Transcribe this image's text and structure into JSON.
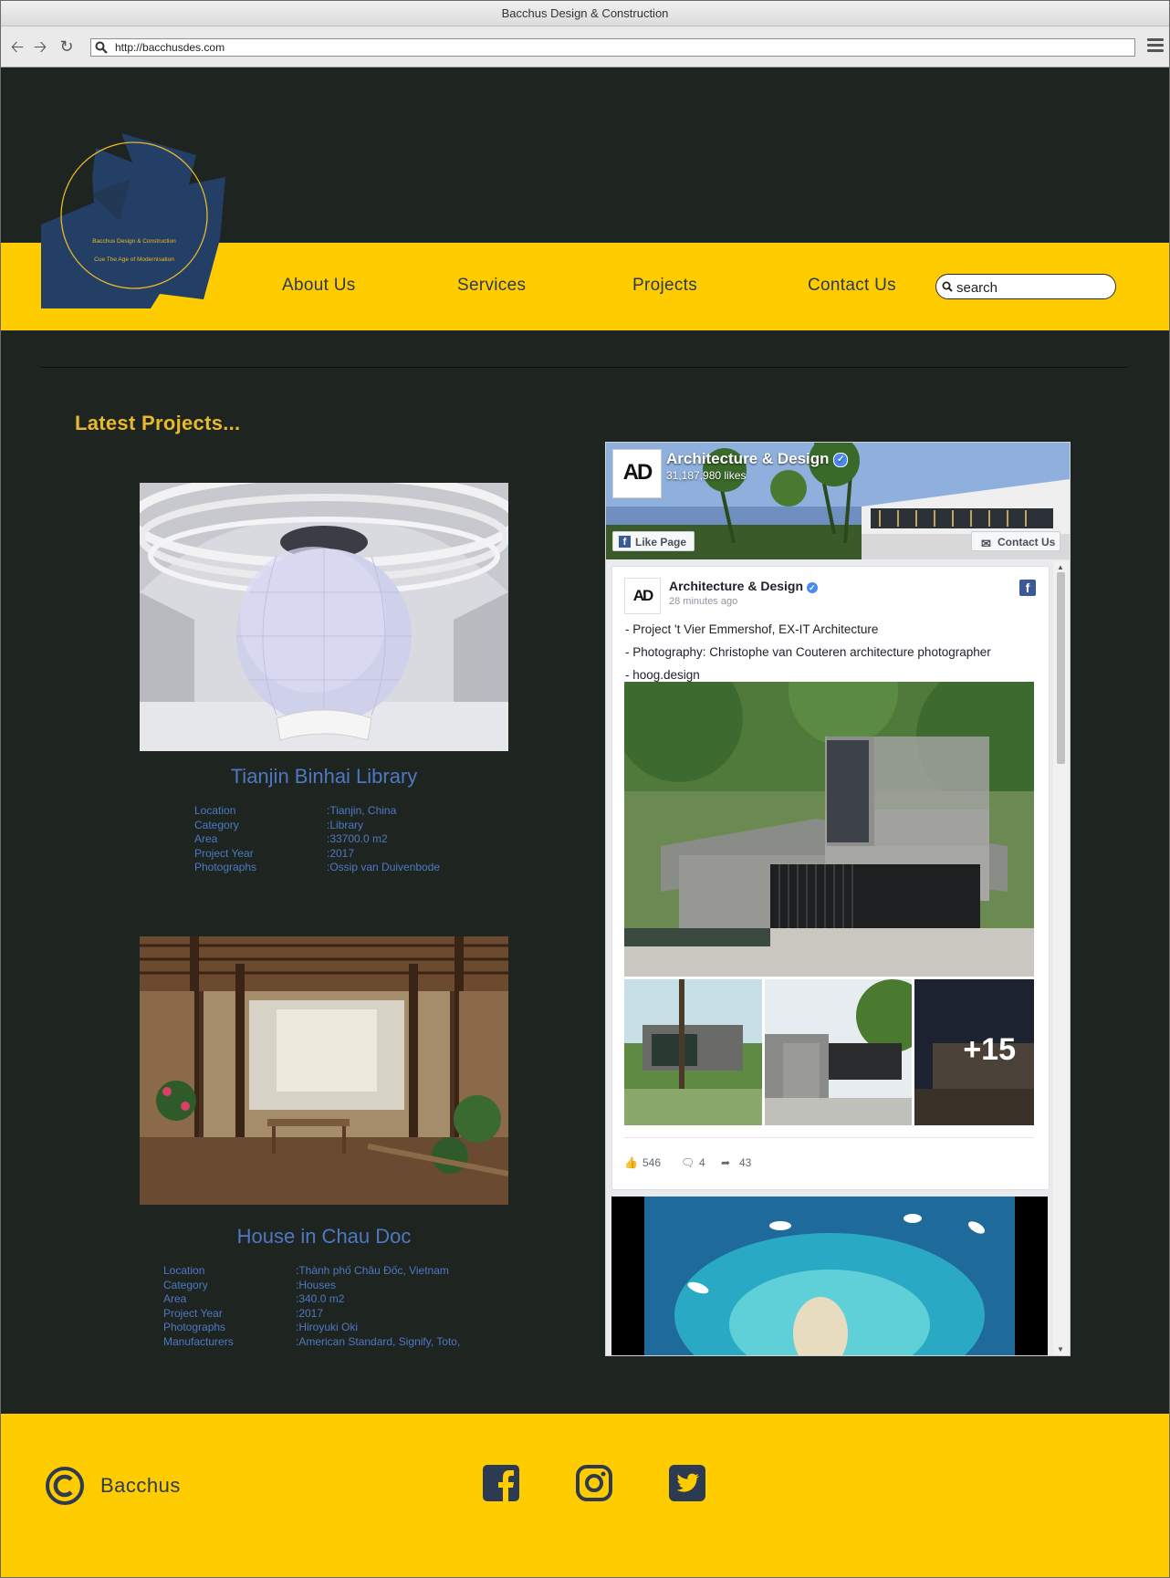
{
  "browser": {
    "window_title": "Bacchus Design & Construction",
    "url": "http://bacchusdes.com"
  },
  "logo": {
    "line1": "Bacchus Design & Construction",
    "line2": "Cue The Age of Modernisation"
  },
  "nav": {
    "items": [
      {
        "label": "About Us"
      },
      {
        "label": "Services"
      },
      {
        "label": "Projects"
      },
      {
        "label": "Contact Us"
      }
    ],
    "search_placeholder": "search"
  },
  "section_title": "Latest Projects...",
  "projects": [
    {
      "title": "Tianjin Binhai Library",
      "specs": [
        {
          "key": "Location",
          "value": ":Tianjin, China"
        },
        {
          "key": "Category",
          "value": ":Library"
        },
        {
          "key": "Area",
          "value": ":33700.0 m2"
        },
        {
          "key": "Project Year",
          "value": ":2017"
        },
        {
          "key": "Photographs",
          "value": ":Ossip van Duivenbode"
        }
      ]
    },
    {
      "title": "House in Chau Doc",
      "specs": [
        {
          "key": "Location",
          "value": ":Thành phố Châu Đốc, Vietnam"
        },
        {
          "key": "Category",
          "value": ":Houses"
        },
        {
          "key": "Area",
          "value": ":340.0 m2"
        },
        {
          "key": "Project Year",
          "value": ":2017"
        },
        {
          "key": "Photographs",
          "value": ":Hiroyuki Oki"
        },
        {
          "key": "Manufacturers",
          "value": ":American Standard, Signify, Toto,"
        }
      ]
    }
  ],
  "facebook": {
    "page_name": "Architecture & Design",
    "likes": "31,187,980 likes",
    "like_button": "Like Page",
    "contact_button": "Contact Us",
    "logo_text": "AD",
    "post": {
      "author": "Architecture & Design",
      "time": "28 minutes ago",
      "lines": [
        "- Project 't Vier Emmershof, EX-IT Architecture",
        "- Photography: Christophe van Couteren architecture photographer",
        "- hoog.design"
      ],
      "more_photos": "+15",
      "likes": "546",
      "comments": "4",
      "shares": "43"
    }
  },
  "footer": {
    "brand": "Bacchus",
    "social": [
      "facebook-icon",
      "instagram-icon",
      "twitter-icon"
    ]
  },
  "colors": {
    "background": "#1e2420",
    "accent_yellow": "#ffcc00",
    "navy": "#2c3a52",
    "project_blue": "#4f78c2",
    "heading_gold": "#e8b92a"
  }
}
